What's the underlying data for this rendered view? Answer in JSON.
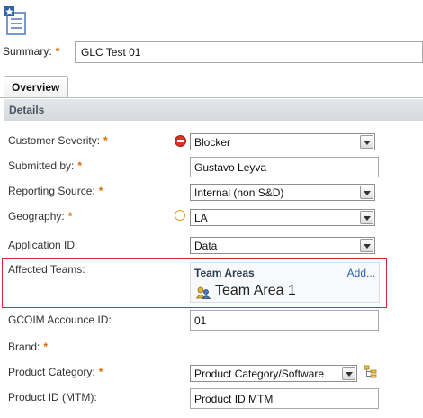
{
  "summary": {
    "label": "Summary:",
    "required": "*",
    "value": "GLC Test 01"
  },
  "tabs": [
    {
      "label": "Overview"
    }
  ],
  "section": {
    "title": "Details"
  },
  "fields": {
    "customer_severity": {
      "label": "Customer Severity:",
      "required": "*",
      "value": "Blocker",
      "status_icon": "blocker-icon"
    },
    "submitted_by": {
      "label": "Submitted by:",
      "required": "*",
      "value": "Gustavo Leyva"
    },
    "reporting_source": {
      "label": "Reporting Source:",
      "required": "*",
      "value": "Internal (non S&D)"
    },
    "geography": {
      "label": "Geography:",
      "required": "*",
      "value": "LA",
      "status_icon": "circle-icon"
    },
    "application_id": {
      "label": "Application ID:",
      "value": "Data"
    },
    "affected_teams": {
      "label": "Affected Teams:",
      "panel_title": "Team Areas",
      "add_label": "Add...",
      "items": [
        {
          "label": "Team Area 1",
          "icon": "team-area-icon"
        }
      ]
    },
    "gcoim_account_id": {
      "label": "GCOIM Accounce ID:",
      "value": "01"
    },
    "brand": {
      "label": "Brand:",
      "required": "*"
    },
    "product_category": {
      "label": "Product Category:",
      "required": "*",
      "value": "Product Category/Software",
      "side_icon": "hierarchy-picker-icon"
    },
    "product_id": {
      "label": "Product ID (MTM):",
      "value": "Product ID MTM"
    }
  },
  "colors": {
    "required": "#e06a00",
    "highlight": "#d9292c",
    "link": "#2a62b8",
    "section_bg": "#dde1e5"
  }
}
